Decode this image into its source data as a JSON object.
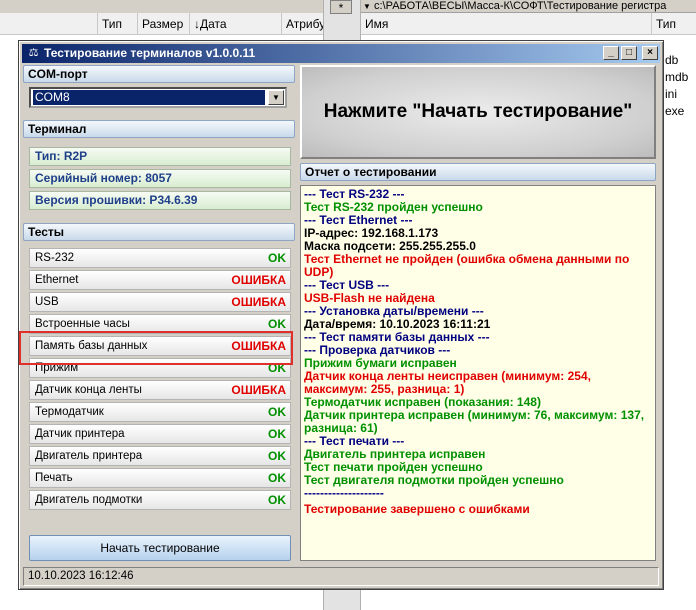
{
  "background": {
    "left_headers": [
      "Тип",
      "Размер",
      "Дата",
      "Атрибу"
    ],
    "date_arrow": "↓",
    "star": "*",
    "path": "c:\\РАБОТА\\ВЕСЫ\\Масса-К\\СОФТ\\Тестирование регистра",
    "right_headers": [
      "Имя",
      "Тип"
    ],
    "file_types": [
      "db",
      "mdb",
      "ini",
      "exe"
    ]
  },
  "window": {
    "title": "Тестирование терминалов v1.0.0.11",
    "icon": "scale-icon",
    "controls": [
      "_",
      "□",
      "×"
    ]
  },
  "com": {
    "header": "COM-порт",
    "selected": "COM8"
  },
  "terminal": {
    "header": "Терминал",
    "type": "Тип: R2P",
    "serial": "Серийный номер: 8057",
    "firmware": "Версия прошивки: P34.6.39"
  },
  "tests": {
    "header": "Тесты",
    "items": [
      {
        "name": "RS-232",
        "status": "OK"
      },
      {
        "name": "Ethernet",
        "status": "ОШИБКА"
      },
      {
        "name": "USB",
        "status": "ОШИБКА"
      },
      {
        "name": "Встроенные часы",
        "status": "OK"
      },
      {
        "name": "Память базы данных",
        "status": "ОШИБКА"
      },
      {
        "name": "Прижим",
        "status": "OK"
      },
      {
        "name": "Датчик конца ленты",
        "status": "ОШИБКА"
      },
      {
        "name": "Термодатчик",
        "status": "OK"
      },
      {
        "name": "Датчик принтера",
        "status": "OK"
      },
      {
        "name": "Двигатель принтера",
        "status": "OK"
      },
      {
        "name": "Печать",
        "status": "OK"
      },
      {
        "name": "Двигатель подмотки",
        "status": "OK"
      }
    ],
    "start_button": "Начать тестирование"
  },
  "banner": "Нажмите \"Начать тестирование\"",
  "report": {
    "header": "Отчет о тестировании",
    "lines": [
      {
        "text": "--- Тест RS-232 ---",
        "kind": "section"
      },
      {
        "text": "Тест RS-232 пройден успешно",
        "kind": "ok"
      },
      {
        "text": "--- Тест Ethernet ---",
        "kind": "section"
      },
      {
        "text": "IP-адрес: 192.168.1.173",
        "kind": "info"
      },
      {
        "text": "Маска подсети: 255.255.255.0",
        "kind": "info"
      },
      {
        "text": "Тест Ethernet не пройден (ошибка обмена данными по UDP)",
        "kind": "error"
      },
      {
        "text": "--- Тест USB ---",
        "kind": "section"
      },
      {
        "text": "USB-Flash не найдена",
        "kind": "error"
      },
      {
        "text": "--- Установка даты/времени ---",
        "kind": "section"
      },
      {
        "text": "Дата/время: 10.10.2023 16:11:21",
        "kind": "info"
      },
      {
        "text": "--- Тест памяти базы данных ---",
        "kind": "section"
      },
      {
        "text": "--- Проверка датчиков ---",
        "kind": "section"
      },
      {
        "text": "Прижим бумаги исправен",
        "kind": "ok"
      },
      {
        "text": "Датчик конца ленты неисправен (минимум: 254, максимум: 255, разница: 1)",
        "kind": "error"
      },
      {
        "text": "Термодатчик исправен (показания: 148)",
        "kind": "ok"
      },
      {
        "text": "Датчик принтера исправен (минимум: 76, максимум: 137, разница: 61)",
        "kind": "ok"
      },
      {
        "text": "--- Тест печати ---",
        "kind": "section"
      },
      {
        "text": "Двигатель принтера исправен",
        "kind": "ok"
      },
      {
        "text": "Тест печати пройден успешно",
        "kind": "ok"
      },
      {
        "text": "Тест двигателя подмотки пройден успешно",
        "kind": "ok"
      },
      {
        "text": "--------------------",
        "kind": "section"
      },
      {
        "text": "Тестирование завершено с ошибками",
        "kind": "error"
      }
    ]
  },
  "status_bar": "10.10.2023 16:12:46",
  "colors": {
    "ok": "#009000",
    "error": "#e00000",
    "section": "#00007f",
    "info": "#000000",
    "titlebar": "#0a246a",
    "highlight": "#e0302c"
  }
}
